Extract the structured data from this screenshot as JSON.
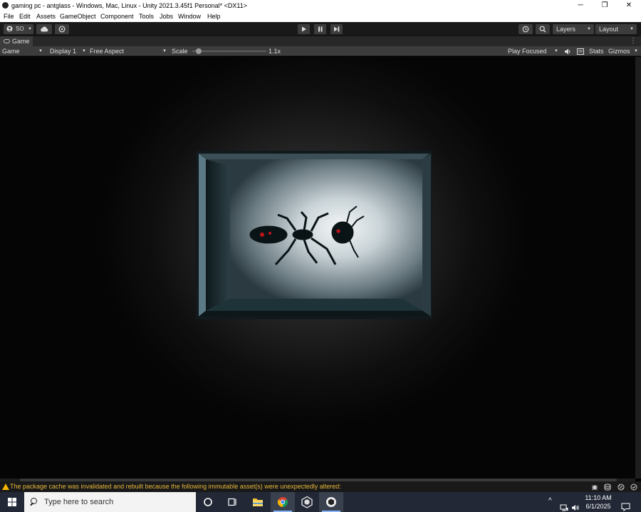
{
  "window": {
    "title": "gaming pc - antglass - Windows, Mac, Linux - Unity 2021.3.45f1 Personal* <DX11>",
    "controls": {
      "minimize": "─",
      "restore": "❐",
      "close": "✕"
    }
  },
  "menu": [
    "File",
    "Edit",
    "Assets",
    "GameObject",
    "Component",
    "Tools",
    "Jobs",
    "Window",
    "Help"
  ],
  "toolbar": {
    "account_label": "SO",
    "layers_label": "Layers",
    "layout_label": "Layout"
  },
  "game_tab": {
    "label": "Game"
  },
  "game_controls": {
    "view_select": "Game",
    "display_select": "Display 1",
    "aspect_select": "Free Aspect",
    "scale_label": "Scale",
    "scale_value": "1.1x",
    "scale_level": 0.05,
    "play_mode_select": "Play Focused",
    "stats_label": "Stats",
    "gizmos_label": "Gizmos"
  },
  "status": {
    "warning_message": "The package cache was invalidated and rebuilt because the following immutable asset(s) were unexpectedly altered:"
  },
  "taskbar": {
    "search_placeholder": "Type here to search",
    "time": "11:10 AM",
    "date": "6/1/2025"
  },
  "colors": {
    "editor_dark": "#191919",
    "panel": "#3c3c3c",
    "warning": "#e7b73c",
    "taskbar": "#222836"
  }
}
